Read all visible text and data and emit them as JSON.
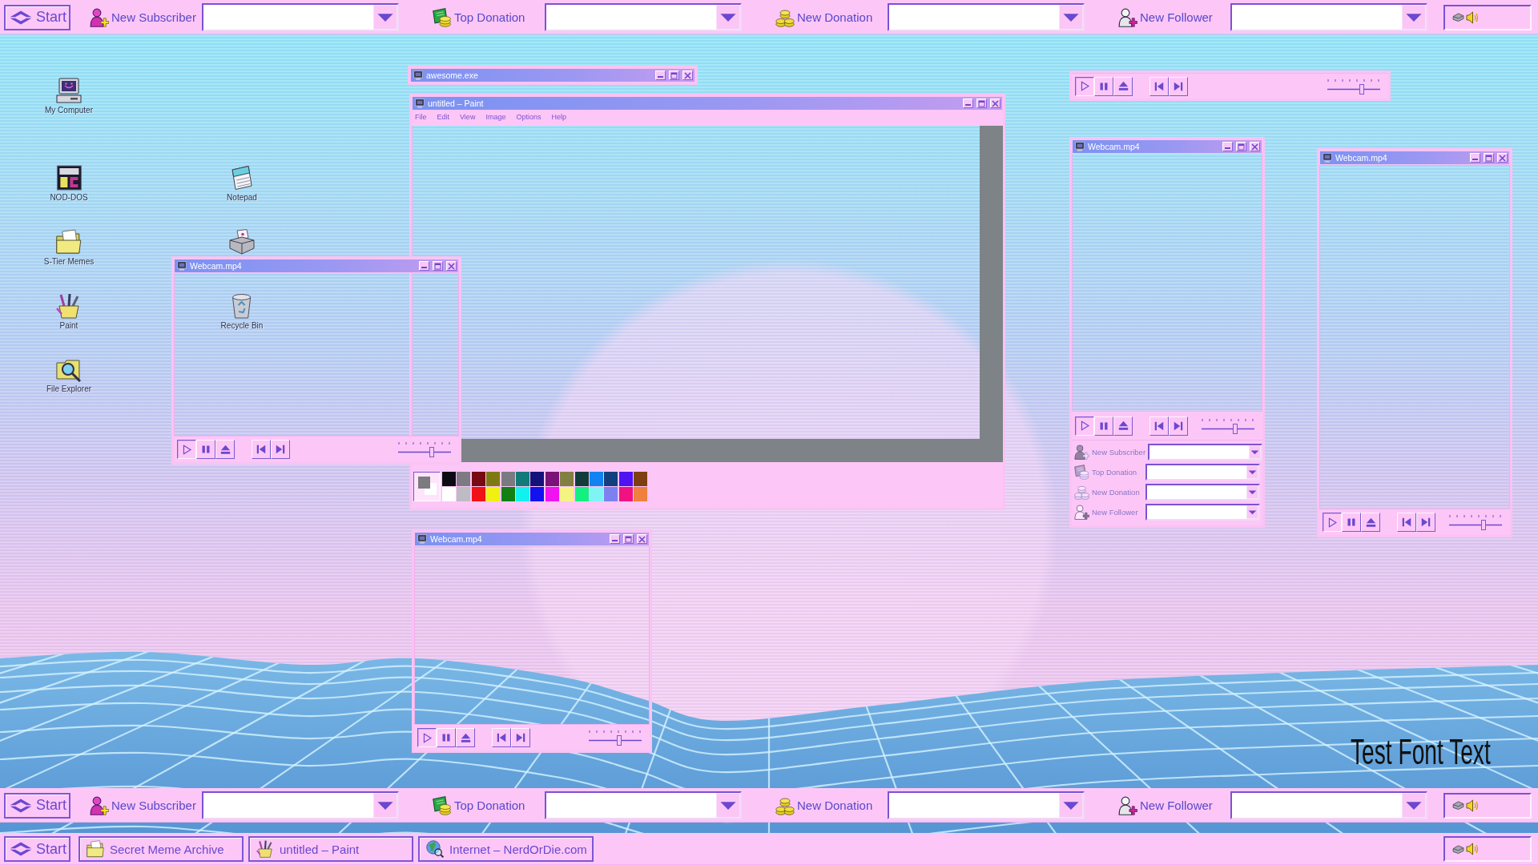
{
  "top_bar": {
    "start": "Start",
    "alerts": [
      {
        "kind": "subscriber",
        "label": "New Subscriber"
      },
      {
        "kind": "top_donation",
        "label": "Top Donation"
      },
      {
        "kind": "donation",
        "label": "New Donation"
      },
      {
        "kind": "follower",
        "label": "New Follower"
      }
    ]
  },
  "desktop_icons": [
    {
      "kind": "computer",
      "label": "My Computer"
    },
    {
      "kind": "nod_dos",
      "label": "NOD-DOS"
    },
    {
      "kind": "notepad",
      "label": "Notepad"
    },
    {
      "kind": "folder",
      "label": "S-Tier Memes"
    },
    {
      "kind": "printer"
    },
    {
      "kind": "paint",
      "label": "Paint"
    },
    {
      "kind": "recycle_bin",
      "label": "Recycle Bin"
    },
    {
      "kind": "explorer",
      "label": "File Explorer"
    }
  ],
  "windows": [
    {
      "kind": "title_only",
      "title": "awesome.exe"
    },
    {
      "kind": "paint",
      "title": "untitled – Paint",
      "menu": [
        "File",
        "Edit",
        "View",
        "Image",
        "Options",
        "Help"
      ],
      "current_colors": [
        {
          "kind": "background",
          "color": "#ffffff"
        },
        {
          "kind": "foreground",
          "color": "#7b7b80"
        }
      ],
      "palette": [
        {
          "color": "#0d0a12"
        },
        {
          "color": "#7e7a84"
        },
        {
          "color": "#780a14"
        },
        {
          "color": "#7e7a12"
        },
        {
          "color": "#7a7a80"
        },
        {
          "color": "#127a78"
        },
        {
          "color": "#14127a"
        },
        {
          "color": "#7a127a"
        },
        {
          "color": "#808040"
        },
        {
          "color": "#123c3c"
        },
        {
          "color": "#1282f0"
        },
        {
          "color": "#12407e"
        },
        {
          "color": "#5012f0"
        },
        {
          "color": "#7e4012"
        },
        {
          "color": "#ffffff"
        },
        {
          "color": "#bdbcc2"
        },
        {
          "color": "#f01216"
        },
        {
          "color": "#f0f012"
        },
        {
          "color": "#128012"
        },
        {
          "color": "#12f0f0"
        },
        {
          "color": "#1212f0"
        },
        {
          "color": "#f012f0"
        },
        {
          "color": "#f4f482"
        },
        {
          "color": "#12f080"
        },
        {
          "color": "#80f4f4"
        },
        {
          "color": "#7e80f0"
        },
        {
          "color": "#f01280"
        },
        {
          "color": "#f08040"
        }
      ]
    },
    {
      "kind": "controls",
      "playing": true,
      "level": 0.66
    },
    {
      "kind": "player",
      "title": "Webcam.mp4",
      "playing": true,
      "level": 0.64
    },
    {
      "kind": "player_alerts",
      "title": "Webcam.mp4",
      "playing": true,
      "level": 0.65,
      "alerts": [
        {
          "kind": "subscriber",
          "label": "New Subscriber"
        },
        {
          "kind": "top_donation",
          "label": "Top Donation"
        },
        {
          "kind": "donation",
          "label": "New Donation"
        },
        {
          "kind": "follower",
          "label": "New Follower"
        }
      ]
    },
    {
      "kind": "player",
      "title": "Webcam.mp4",
      "playing": true,
      "level": 0.66
    },
    {
      "kind": "player",
      "title": "Webcam.mp4",
      "playing": true,
      "level": 0.58
    }
  ],
  "overlay_text": "Test Font Text",
  "bottom_bar": {
    "start": "Start",
    "alerts": [
      {
        "kind": "subscriber",
        "label": "New Subscriber"
      },
      {
        "kind": "top_donation",
        "label": "Top Donation"
      },
      {
        "kind": "donation",
        "label": "New Donation"
      },
      {
        "kind": "follower",
        "label": "New Follower"
      }
    ]
  },
  "taskbar": {
    "start": "Start",
    "tasks": [
      {
        "kind": "folder",
        "label": "Secret Meme Archive"
      },
      {
        "kind": "paint",
        "label": "untitled – Paint"
      },
      {
        "kind": "internet",
        "label": "Internet – NerdOrDie.com"
      }
    ]
  }
}
